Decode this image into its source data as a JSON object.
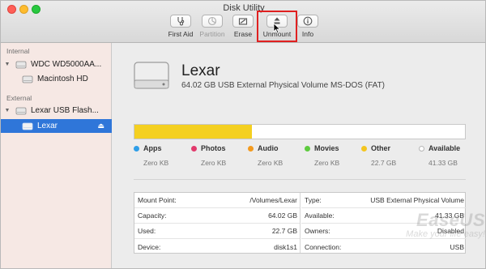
{
  "window": {
    "title": "Disk Utility"
  },
  "toolbar": {
    "items": [
      {
        "label": "First Aid",
        "icon": "stethoscope-icon",
        "enabled": true
      },
      {
        "label": "Partition",
        "icon": "partition-icon",
        "enabled": false
      },
      {
        "label": "Erase",
        "icon": "erase-icon",
        "enabled": true
      },
      {
        "label": "Unmount",
        "icon": "unmount-icon",
        "enabled": true,
        "highlighted": true
      },
      {
        "label": "Info",
        "icon": "info-icon",
        "enabled": true
      }
    ]
  },
  "sidebar": {
    "internal_label": "Internal",
    "external_label": "External",
    "internal_disk": "WDC WD5000AA...",
    "internal_volume": "Macintosh HD",
    "external_disk": "Lexar USB Flash...",
    "external_volume": "Lexar",
    "eject_symbol": "⏏"
  },
  "volume": {
    "name": "Lexar",
    "description": "64.02 GB USB External Physical Volume MS-DOS (FAT)"
  },
  "usage": {
    "other_fraction": 0.355,
    "categories": [
      {
        "name": "Apps",
        "size": "Zero KB",
        "color": "#2e9ee8"
      },
      {
        "name": "Photos",
        "size": "Zero KB",
        "color": "#e23a6c"
      },
      {
        "name": "Audio",
        "size": "Zero KB",
        "color": "#f39a1e"
      },
      {
        "name": "Movies",
        "size": "Zero KB",
        "color": "#5ecb3f"
      },
      {
        "name": "Other",
        "size": "22.7 GB",
        "color": "#f4c51f"
      },
      {
        "name": "Available",
        "size": "41.33 GB",
        "color": "#ffffff"
      }
    ]
  },
  "details": {
    "left": [
      {
        "label": "Mount Point:",
        "value": "/Volumes/Lexar"
      },
      {
        "label": "Capacity:",
        "value": "64.02 GB"
      },
      {
        "label": "Used:",
        "value": "22.7 GB"
      },
      {
        "label": "Device:",
        "value": "disk1s1"
      }
    ],
    "right": [
      {
        "label": "Type:",
        "value": "USB External Physical Volume"
      },
      {
        "label": "Available:",
        "value": "41.33 GB"
      },
      {
        "label": "Owners:",
        "value": "Disabled"
      },
      {
        "label": "Connection:",
        "value": "USB"
      }
    ]
  },
  "watermark": {
    "brand": "EaseUS",
    "tagline": "Make your life easy!"
  }
}
